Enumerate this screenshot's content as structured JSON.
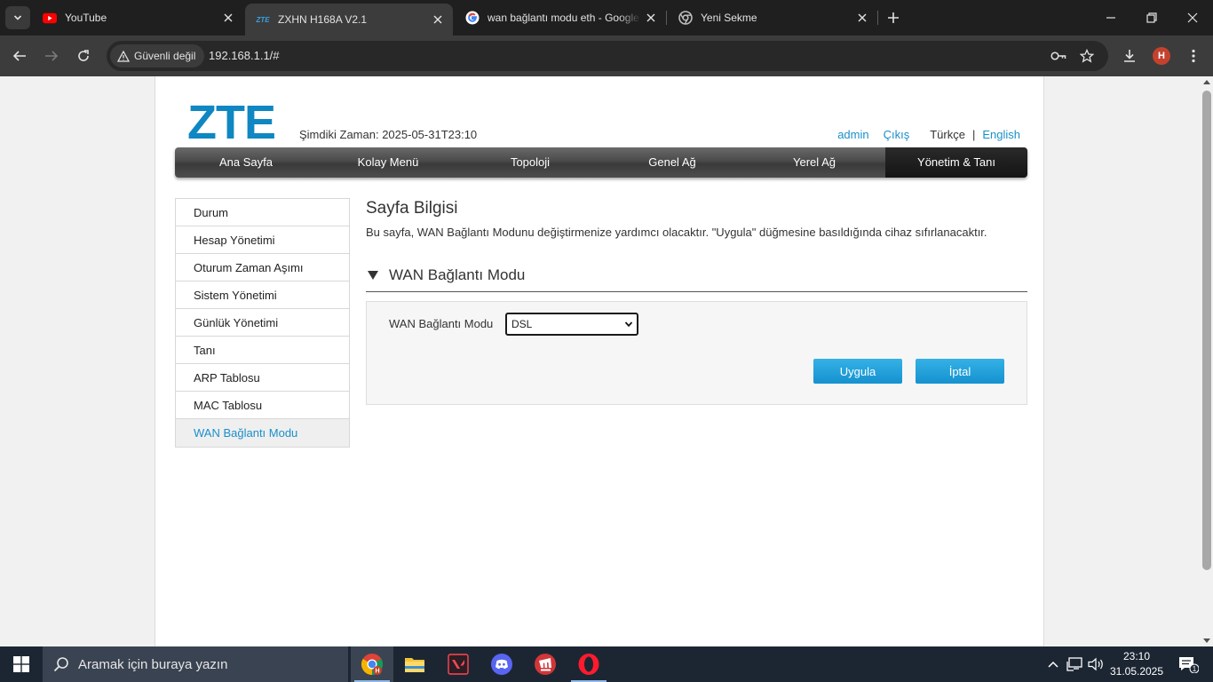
{
  "browser": {
    "tabs": [
      {
        "title": "YouTube",
        "icon": "youtube-icon"
      },
      {
        "title": "ZXHN H168A V2.1",
        "icon": "zte-favicon",
        "active": true
      },
      {
        "title": "wan bağlantı modu eth - Google",
        "icon": "google-icon"
      },
      {
        "title": "Yeni Sekme",
        "icon": "chrome-icon"
      }
    ],
    "security_chip": "Güvenli değil",
    "url": "192.168.1.1/#",
    "profile_initial": "H",
    "favicon_text": "ZTE"
  },
  "router": {
    "logo": "ZTE",
    "current_time": "Şimdiki Zaman: 2025-05-31T23:10",
    "top_links": {
      "user": "admin",
      "logout": "Çıkış",
      "lang_tr": "Türkçe",
      "separator": "|",
      "lang_en": "English"
    },
    "main_nav": [
      "Ana Sayfa",
      "Kolay Menü",
      "Topoloji",
      "Genel Ağ",
      "Yerel Ağ",
      "Yönetim & Tanı"
    ],
    "main_nav_active": "Yönetim & Tanı",
    "side_menu": [
      "Durum",
      "Hesap Yönetimi",
      "Oturum Zaman Aşımı",
      "Sistem Yönetimi",
      "Günlük Yönetimi",
      "Tanı",
      "ARP Tablosu",
      "MAC Tablosu",
      "WAN Bağlantı Modu"
    ],
    "side_menu_active": "WAN Bağlantı Modu",
    "page_title": "Sayfa Bilgisi",
    "page_description": "Bu sayfa, WAN Bağlantı Modunu değiştirmenize yardımcı olacaktır. \"Uygula\" düğmesine basıldığında cihaz sıfırlanacaktır.",
    "section_title": "WAN Bağlantı Modu",
    "field_label": "WAN Bağlantı Modu",
    "field_value": "DSL",
    "apply_button": "Uygula",
    "cancel_button": "İptal",
    "colors": {
      "brand": "#0f87c2",
      "link": "#1a8fc9",
      "button": "#1592cf"
    }
  },
  "taskbar": {
    "search_placeholder": "Aramak için buraya yazın",
    "time": "23:10",
    "date": "31.05.2025",
    "notification_count": "1",
    "apps": [
      "chrome-icon",
      "file-explorer-icon",
      "valorant-icon",
      "discord-icon",
      "riot-client-icon",
      "opera-icon"
    ]
  }
}
